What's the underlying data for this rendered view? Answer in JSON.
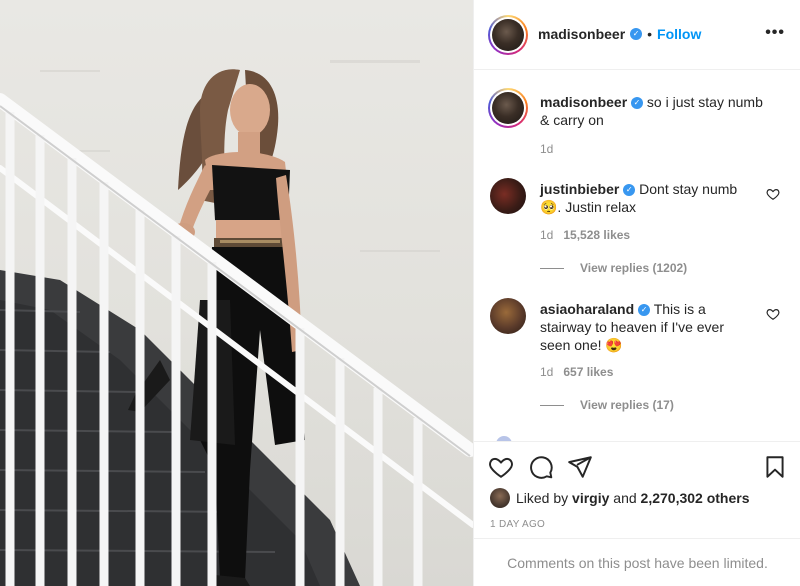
{
  "post": {
    "author": "madisonbeer",
    "follow_label": "Follow",
    "dot": "•",
    "more_label": "•••",
    "verified_glyph": "✓"
  },
  "caption": {
    "username": "madisonbeer",
    "text_line1": "so i just stay numb",
    "text_line2": "& carry on",
    "age": "1d"
  },
  "comments": [
    {
      "username": "justinbieber",
      "text_line1": "Dont stay numb",
      "text_line2": "🥺. Justin relax",
      "age": "1d",
      "likes": "15,528 likes",
      "view_replies": "View replies (1202)"
    },
    {
      "username": "asiaoharaland",
      "text_line1": "This is a",
      "text_line2": "stairway to heaven if I've ever",
      "text_line3": "seen one! 😍",
      "age": "1d",
      "likes": "657 likes",
      "view_replies": "View replies (17)"
    }
  ],
  "engagement": {
    "liked_by_prefix": "Liked by",
    "liked_by_user": "virgiy",
    "liked_by_joiner": "and",
    "liked_by_count": "2,270,302 others",
    "date": "1 DAY AGO",
    "limited_notice": "Comments on this post have been limited."
  },
  "icons": {
    "like": "heart-icon",
    "comment": "comment-icon",
    "share": "paper-plane-icon",
    "save": "bookmark-icon",
    "more": "more-options-icon",
    "verified": "verified-badge-icon"
  },
  "colors": {
    "accent": "#0095f6",
    "verified": "#3897f0",
    "muted": "#8e8e8e",
    "text": "#262626",
    "divider": "#efefef"
  }
}
